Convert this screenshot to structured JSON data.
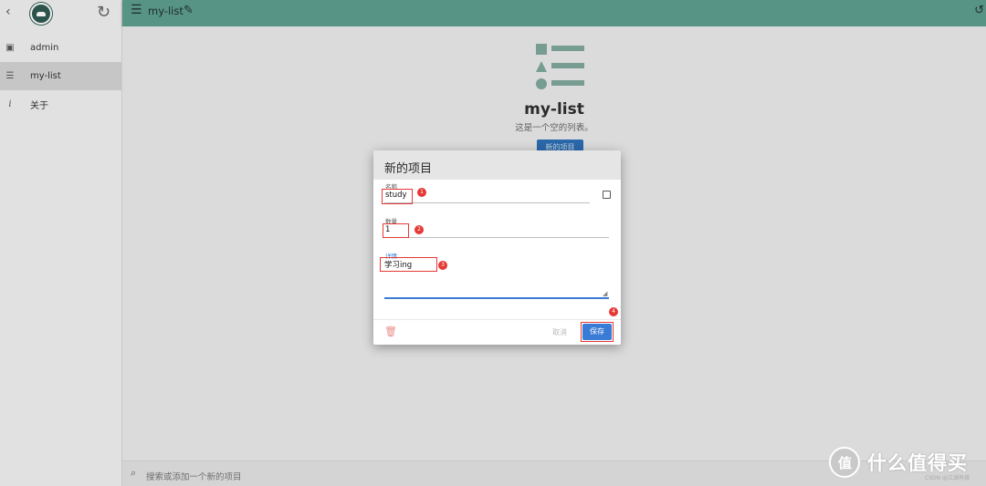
{
  "sidebar": {
    "back_icon": "‹",
    "refresh_icon": "↻",
    "items": [
      {
        "icon": "clipboard-icon",
        "glyph": "▣",
        "label": "admin"
      },
      {
        "icon": "list-icon",
        "glyph": "☰",
        "label": "my-list"
      },
      {
        "icon": "info-icon",
        "glyph": "i",
        "label": "关于"
      }
    ],
    "active_index": 1
  },
  "topbar": {
    "menu_icon": "☰",
    "title": "my-list",
    "edit_icon": "✎",
    "history_icon": "↺",
    "color": "#5e9e8f"
  },
  "main": {
    "empty_title": "my-list",
    "empty_subtitle": "这是一个空的列表。",
    "new_item_button": "新的项目"
  },
  "dialog": {
    "title": "新的项目",
    "name_label": "名称",
    "name_value": "study",
    "quantity_label": "数量",
    "quantity_value": "1",
    "details_label": "详情",
    "details_value": "学习ing",
    "cancel_label": "取消",
    "save_label": "保存",
    "annotations": [
      "1",
      "2",
      "3",
      "4"
    ],
    "save_color": "#3a7bd5",
    "highlight_color": "#e53935"
  },
  "bottombar": {
    "search_icon": "⌕",
    "placeholder": "搜索或添加一个新的项目"
  },
  "watermark": {
    "text": "什么值得买",
    "small": "CSDN @江湖有缘"
  }
}
